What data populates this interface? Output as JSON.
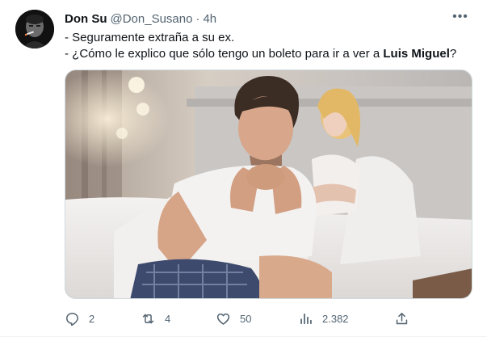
{
  "tweet": {
    "author": {
      "display_name": "Don Su",
      "handle": "@Don_Susano",
      "separator": "·",
      "time": "4h"
    },
    "more_label": "•••",
    "text": {
      "line1": "- Seguramente extraña a su ex.",
      "line2_prefix": "- ¿Cómo le explico que sólo tengo un boleto para ir a ver a ",
      "line2_bold": "Luis Miguel",
      "line2_suffix": "?"
    },
    "media": {
      "icon": "photo"
    },
    "actions": {
      "reply_count": "2",
      "retweet_count": "4",
      "like_count": "50",
      "views_count": "2.382"
    }
  }
}
